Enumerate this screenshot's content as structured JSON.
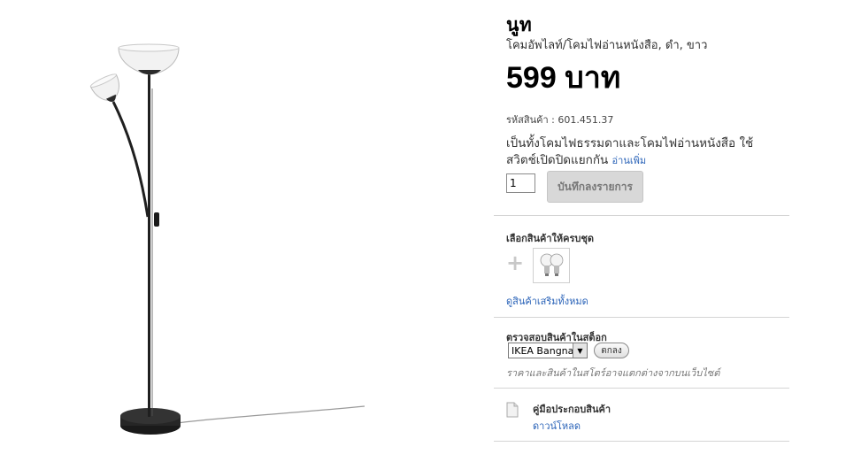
{
  "product": {
    "name": "นูท",
    "subtitle": "โคมอัพไลท์/โคมไฟอ่านหนังสือ, ดำ, ขาว",
    "price": "599 บาท",
    "sku": "รหัสสินค้า : 601.451.37",
    "description": "เป็นทั้งโคมไฟธรรมดาและโคมไฟอ่านหนังสือ ใช้สวิตช์เปิดปิดแยกกัน",
    "read_more": "อ่านเพิ่ม"
  },
  "purchase": {
    "quantity": "1",
    "add_button": "บันทึกลงรายการ"
  },
  "complete_set": {
    "heading": "เลือกสินค้าให้ครบชุด",
    "plus": "+",
    "view_all": "ดูสินค้าเสริมทั้งหมด"
  },
  "stock": {
    "heading": "ตรวจสอบสินค้าในสต็อก",
    "store": "IKEA Bangna",
    "ok_button": "ตกลง",
    "note": "ราคาและสินค้าในสโตร์อาจแตกต่างจากบนเว็บไซต์"
  },
  "manual": {
    "heading": "คู่มือประกอบสินค้า",
    "download": "ดาวน์โหลด"
  },
  "colors": {
    "link": "#2a63b8",
    "lamp_black": "#1f1f1f",
    "divider": "#d4d4d4"
  }
}
